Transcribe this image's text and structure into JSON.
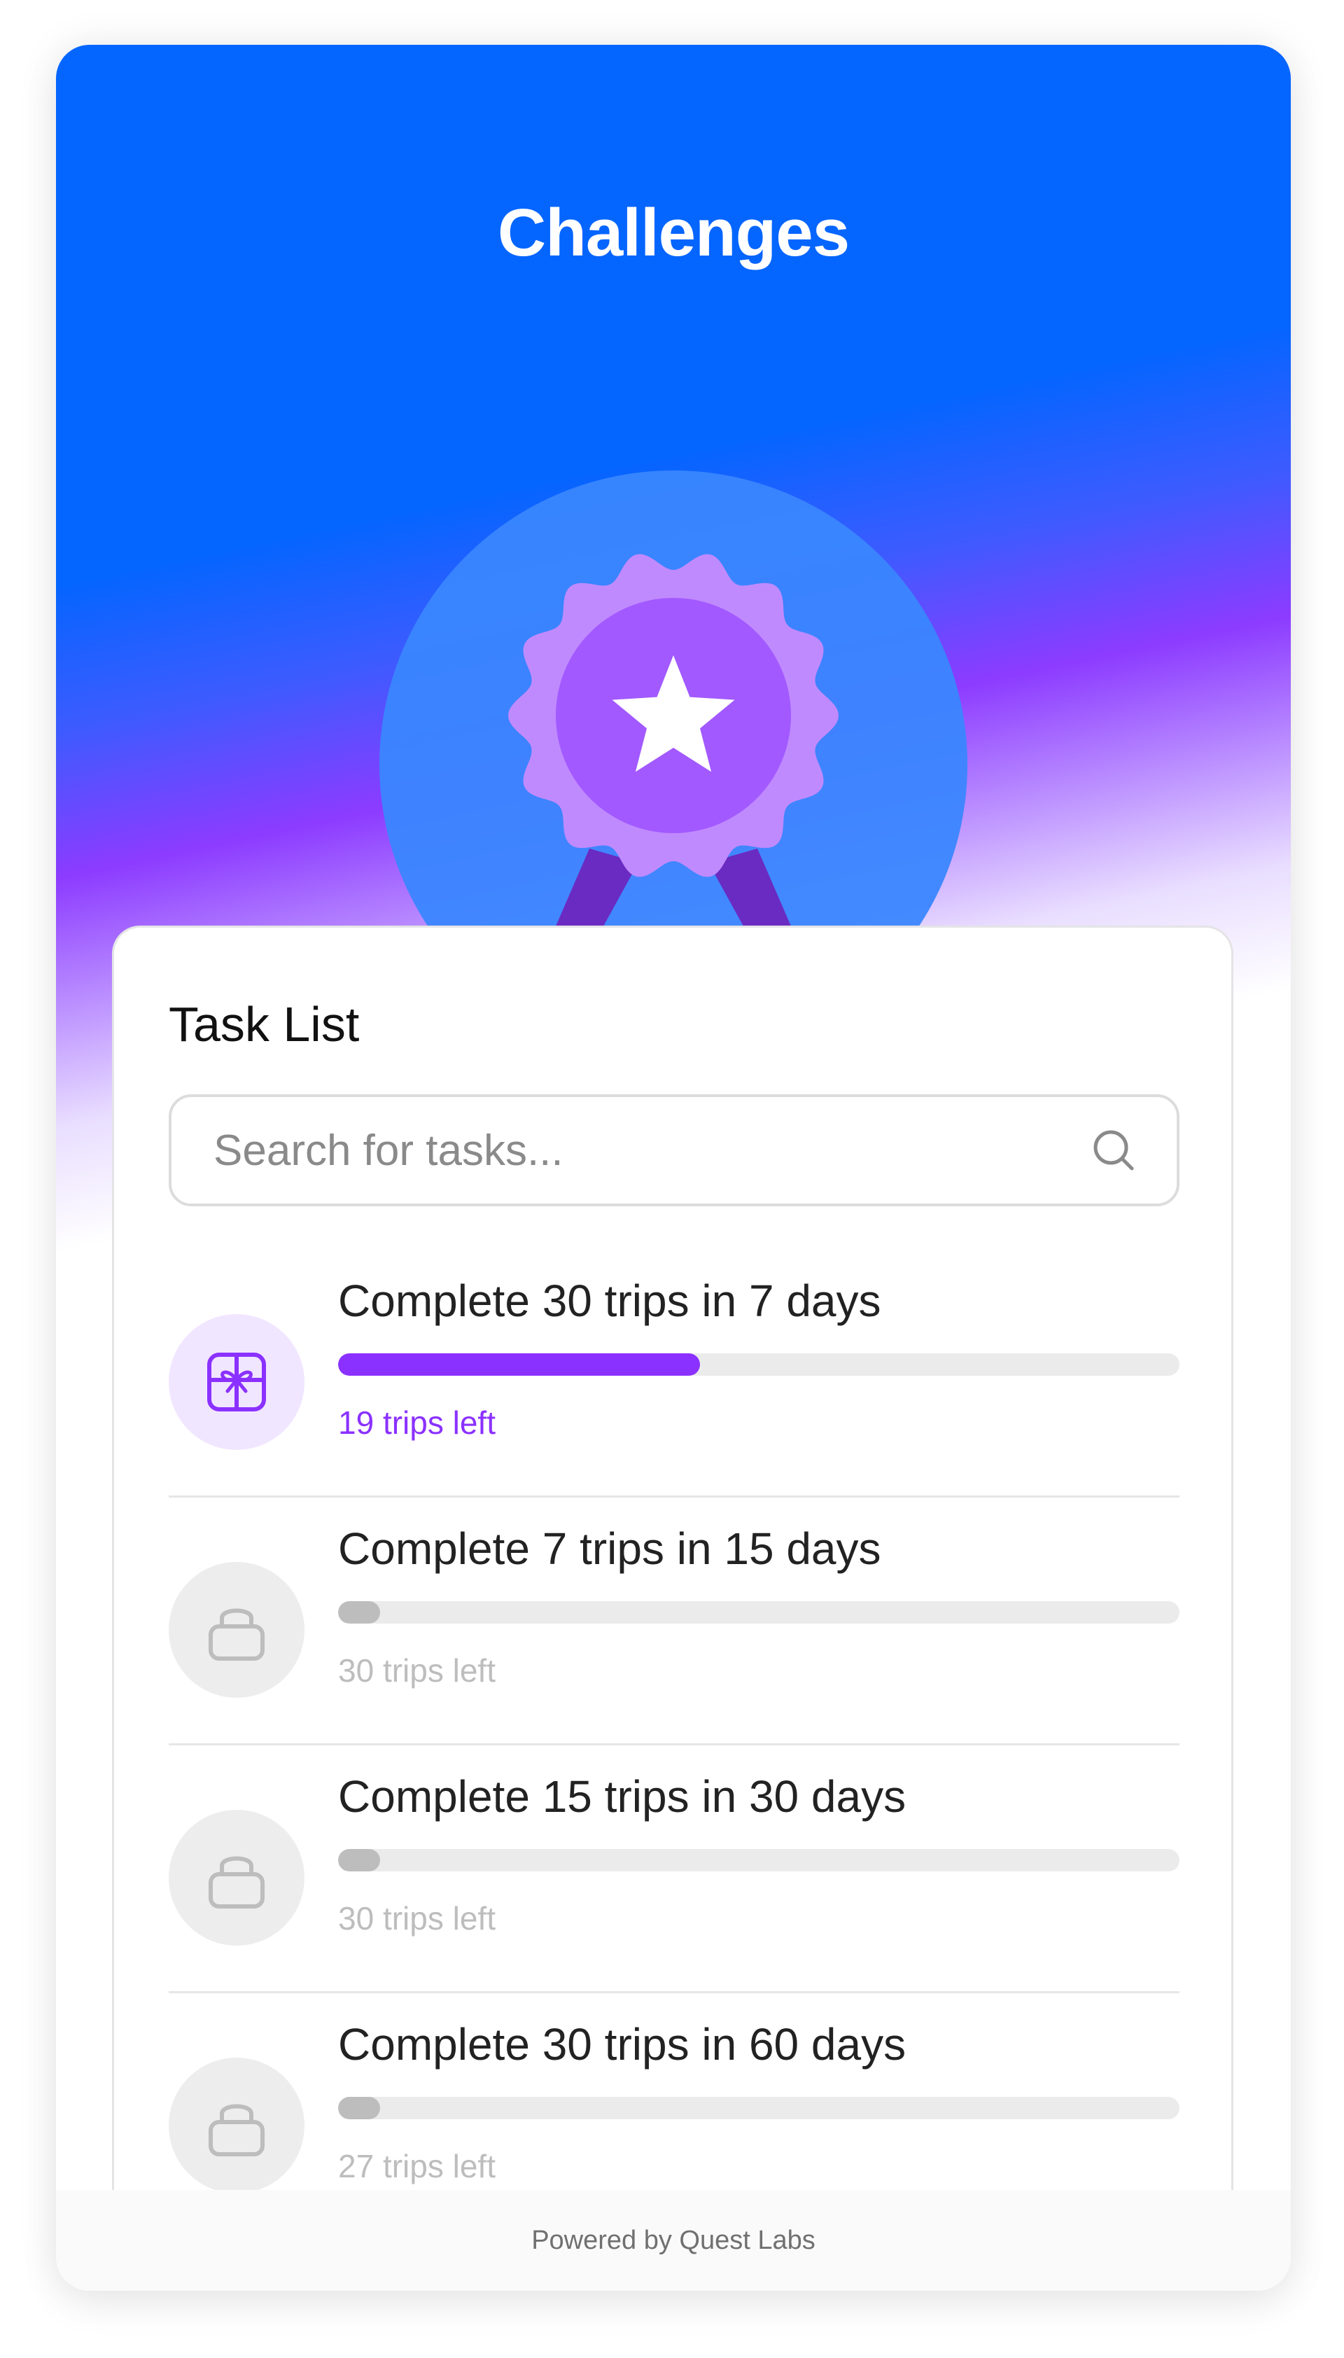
{
  "header": {
    "title": "Challenges"
  },
  "badge": {
    "icon": "award-ribbon-star-icon",
    "colors": {
      "circle": "#3A86FF",
      "rosette_outer": "#C08AFF",
      "rosette_inner": "#A259FF",
      "ribbon": "#6A2BC2",
      "star": "#FFFFFF"
    }
  },
  "task_list": {
    "title": "Task List",
    "search": {
      "placeholder": "Search for tasks...",
      "value": "",
      "icon": "search-icon"
    },
    "tasks": [
      {
        "title": "Complete 30 trips in 7 days",
        "status_text": "19 trips left",
        "progress_pct": 43,
        "state": "active",
        "icon": "gift-icon"
      },
      {
        "title": "Complete 7 trips in 15 days",
        "status_text": "30 trips left",
        "progress_pct": 5,
        "state": "locked",
        "icon": "lock-icon"
      },
      {
        "title": "Complete 15 trips in 30 days",
        "status_text": "30 trips left",
        "progress_pct": 5,
        "state": "locked",
        "icon": "lock-icon"
      },
      {
        "title": "Complete 30 trips in 60 days",
        "status_text": "27 trips left",
        "progress_pct": 5,
        "state": "locked",
        "icon": "lock-icon"
      }
    ]
  },
  "footer": {
    "text": "Powered by Quest Labs"
  },
  "colors": {
    "primary_blue": "#0565FF",
    "accent_purple": "#8B31FF",
    "locked_gray": "#BDBDBD",
    "track_gray": "#EBEBEB"
  }
}
